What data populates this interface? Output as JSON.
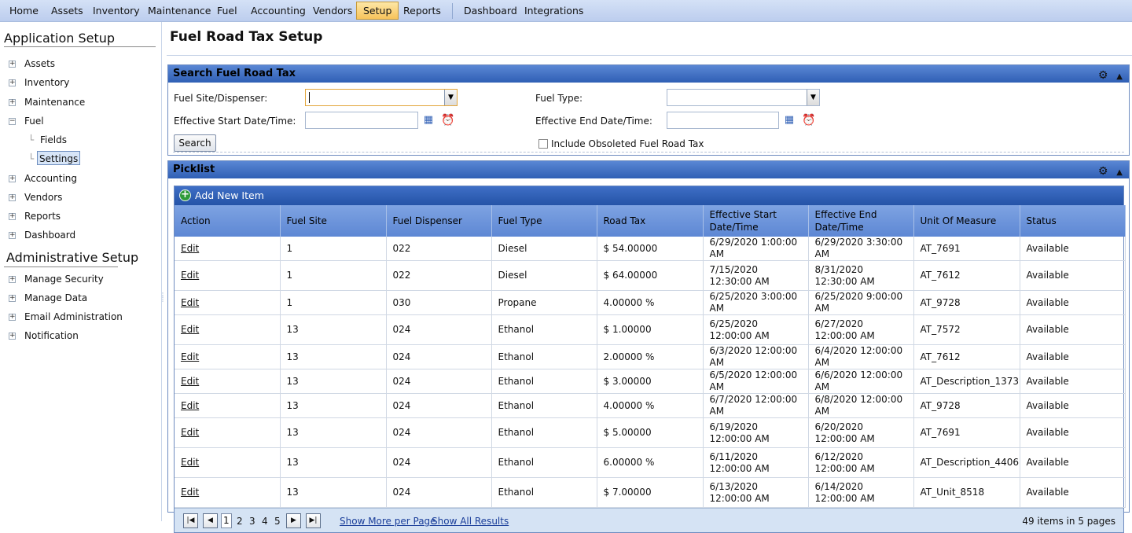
{
  "topnav": {
    "items": [
      "Home",
      "Assets",
      "Inventory",
      "Maintenance",
      "Fuel",
      "Accounting",
      "Vendors",
      "Setup",
      "Reports",
      "Dashboard",
      "Integrations"
    ],
    "active": "Setup"
  },
  "sidebar": {
    "app_heading": "Application Setup",
    "app_items": [
      "Assets",
      "Inventory",
      "Maintenance",
      "Fuel",
      "Fields",
      "Settings",
      "Accounting",
      "Vendors",
      "Reports",
      "Dashboard"
    ],
    "admin_heading": "Administrative Setup",
    "admin_items": [
      "Manage Security",
      "Manage Data",
      "Email Administration",
      "Notification"
    ]
  },
  "page": {
    "title": "Fuel Road Tax Setup"
  },
  "search": {
    "title": "Search Fuel Road Tax",
    "site_label": "Fuel Site/Dispenser:",
    "site_value": "",
    "fuel_type_label": "Fuel Type:",
    "fuel_type_value": "",
    "start_label": "Effective Start Date/Time:",
    "start_value": "",
    "end_label": "Effective End Date/Time:",
    "end_value": "",
    "search_button": "Search",
    "obsolete_label": "Include Obsoleted Fuel Road Tax",
    "obsolete_checked": false
  },
  "picklist": {
    "title": "Picklist",
    "add_label": "Add New Item",
    "columns": [
      "Action",
      "Fuel Site",
      "Fuel Dispenser",
      "Fuel Type",
      "Road Tax",
      "Effective Start Date/Time",
      "Effective End Date/Time",
      "Unit Of Measure",
      "Status"
    ],
    "rows": [
      [
        "Edit",
        "1",
        "022",
        "Diesel",
        "$ 54.00000",
        "6/29/2020 1:00:00 AM",
        "6/29/2020 3:30:00 AM",
        "AT_7691",
        "Available"
      ],
      [
        "Edit",
        "1",
        "022",
        "Diesel",
        "$ 64.00000",
        "7/15/2020 12:30:00 AM",
        "8/31/2020 12:30:00 AM",
        "AT_7612",
        "Available"
      ],
      [
        "Edit",
        "1",
        "030",
        "Propane",
        "4.00000 %",
        "6/25/2020 3:00:00 AM",
        "6/25/2020 9:00:00 AM",
        "AT_9728",
        "Available"
      ],
      [
        "Edit",
        "13",
        "024",
        "Ethanol",
        "$ 1.00000",
        "6/25/2020 12:00:00 AM",
        "6/27/2020 12:00:00 AM",
        "AT_7572",
        "Available"
      ],
      [
        "Edit",
        "13",
        "024",
        "Ethanol",
        "2.00000 %",
        "6/3/2020 12:00:00 AM",
        "6/4/2020 12:00:00 AM",
        "AT_7612",
        "Available"
      ],
      [
        "Edit",
        "13",
        "024",
        "Ethanol",
        "$ 3.00000",
        "6/5/2020 12:00:00 AM",
        "6/6/2020 12:00:00 AM",
        "AT_Description_1373",
        "Available"
      ],
      [
        "Edit",
        "13",
        "024",
        "Ethanol",
        "4.00000 %",
        "6/7/2020 12:00:00 AM",
        "6/8/2020 12:00:00 AM",
        "AT_9728",
        "Available"
      ],
      [
        "Edit",
        "13",
        "024",
        "Ethanol",
        "$ 5.00000",
        "6/19/2020 12:00:00 AM",
        "6/20/2020 12:00:00 AM",
        "AT_7691",
        "Available"
      ],
      [
        "Edit",
        "13",
        "024",
        "Ethanol",
        "6.00000 %",
        "6/11/2020 12:00:00 AM",
        "6/12/2020 12:00:00 AM",
        "AT_Description_4406",
        "Available"
      ],
      [
        "Edit",
        "13",
        "024",
        "Ethanol",
        "$ 7.00000",
        "6/13/2020 12:00:00 AM",
        "6/14/2020 12:00:00 AM",
        "AT_Unit_8518",
        "Available"
      ]
    ],
    "pager": {
      "pages": [
        "1",
        "2",
        "3",
        "4",
        "5"
      ],
      "current": "1",
      "show_more": "Show More per Page",
      "show_all": "Show All Results",
      "info": "49 items in 5 pages"
    }
  }
}
